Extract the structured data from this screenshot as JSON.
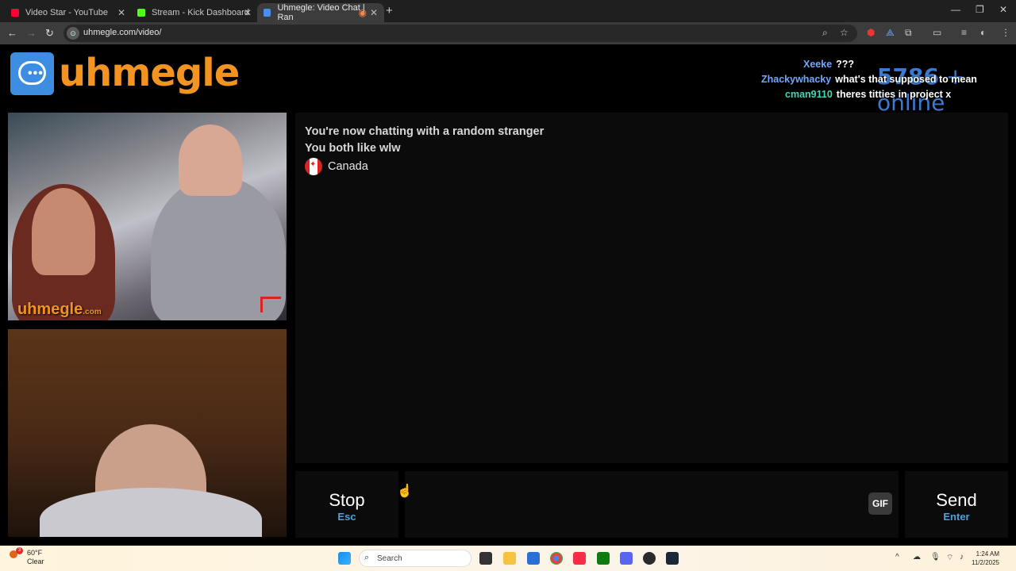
{
  "browser": {
    "tabs": [
      {
        "title": "Video Star - YouTube",
        "color": "#ff0033"
      },
      {
        "title": "Stream - Kick Dashboard",
        "color": "#53fc18"
      },
      {
        "title": "Uhmegle: Video Chat | Ran",
        "color": "#4a8ff0"
      }
    ],
    "url": "uhmegle.com/video/"
  },
  "site": {
    "logo_text": "uhmegle",
    "online_count": "5786",
    "online_label": "+ online"
  },
  "overlay_chat": [
    {
      "user": "Xeeke",
      "text": "???"
    },
    {
      "user": "Zhackywhacky",
      "text": "what's that supposed to mean"
    },
    {
      "user": "cman9110",
      "text": "theres titties in project x"
    }
  ],
  "video": {
    "watermark": "uhmegle",
    "watermark_suffix": ".com"
  },
  "chat": {
    "line1": "You're now chatting with a random stranger",
    "line2": "You both like wlw",
    "country": "Canada"
  },
  "controls": {
    "stop_label": "Stop",
    "stop_key": "Esc",
    "gif_label": "GIF",
    "send_label": "Send",
    "send_key": "Enter"
  },
  "taskbar": {
    "temp": "60°F",
    "condition": "Clear",
    "badge": "3",
    "search_placeholder": "Search",
    "time": "1:24 AM",
    "date": "11/2/2025"
  }
}
